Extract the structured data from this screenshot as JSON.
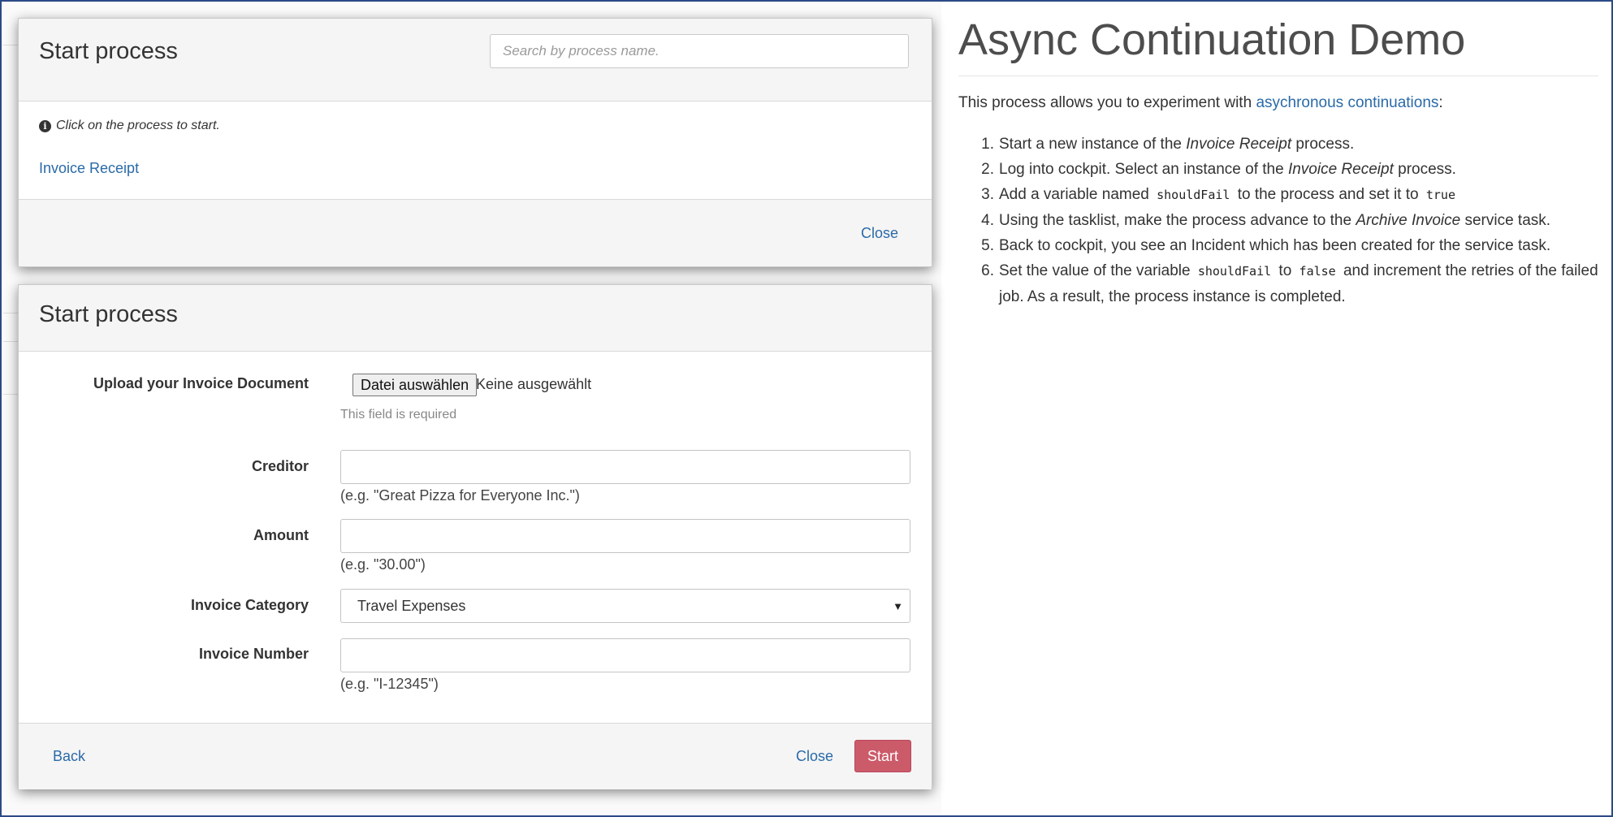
{
  "modal1": {
    "title": "Start process",
    "search_placeholder": "Search by process name.",
    "hint": "Click on the process to start.",
    "processes": [
      "Invoice Receipt"
    ],
    "close_label": "Close"
  },
  "modal2": {
    "title": "Start process",
    "upload": {
      "label": "Upload your Invoice Document",
      "button": "Datei auswählen",
      "status": "Keine ausgewählt",
      "required": "This field is required"
    },
    "creditor": {
      "label": "Creditor",
      "value": "",
      "help": "(e.g. \"Great Pizza for Everyone Inc.\")"
    },
    "amount": {
      "label": "Amount",
      "value": "",
      "help": "(e.g. \"30.00\")"
    },
    "category": {
      "label": "Invoice Category",
      "selected": "Travel Expenses"
    },
    "invoice_number": {
      "label": "Invoice Number",
      "value": "",
      "help": "(e.g. \"I-12345\")"
    },
    "back_label": "Back",
    "close_label": "Close",
    "start_label": "Start"
  },
  "doc": {
    "title": "Async Continuation Demo",
    "intro_prefix": "This process allows you to experiment with ",
    "intro_link": "asychronous continuations",
    "intro_suffix": ":",
    "steps": [
      {
        "num": "1.",
        "t1": "Start a new instance of the ",
        "em": "Invoice Receipt",
        "t2": " process."
      },
      {
        "num": "2.",
        "t1": "Log into cockpit. Select an instance of the ",
        "em": "Invoice Receipt",
        "t2": " process."
      },
      {
        "num": "3.",
        "t1": "Add a variable named ",
        "code1": "shouldFail",
        "t2": " to the process and set it to ",
        "code2": "true"
      },
      {
        "num": "4.",
        "t1": "Using the tasklist, make the process advance to the ",
        "em": "Archive Invoice",
        "t2": " service task."
      },
      {
        "num": "5.",
        "t1": "Back to cockpit, you see an Incident which has been created for the service task."
      },
      {
        "num": "6.",
        "t1": "Set the value of the variable ",
        "code1": "shouldFail",
        "t2": " to ",
        "code2": "false",
        "t3": " and increment the retries of the failed job. As a result, the process instance is completed."
      }
    ]
  },
  "colors": {
    "link": "#2a6aa8",
    "start_button": "#cc5b6a",
    "frame": "#2b4a86"
  }
}
